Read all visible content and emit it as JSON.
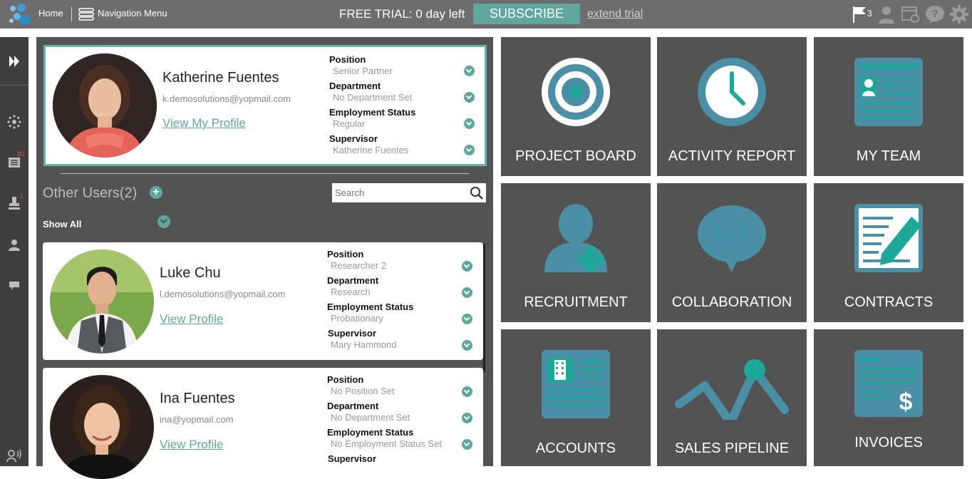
{
  "topbar": {
    "home_label": "Home",
    "nav_label": "Navigation Menu",
    "trial_text": "FREE TRIAL: 0 day left",
    "subscribe_label": "SUBSCRIBE",
    "extend_label": "extend trial",
    "flag_count": "3"
  },
  "sidebar": {
    "badges": {
      "messages": "20",
      "approvals": "1"
    }
  },
  "me": {
    "name": "Katherine Fuentes",
    "email": "k.demosolutions@yopmail.com",
    "view_label": "View My Profile",
    "fields": [
      {
        "label": "Position",
        "value": "Senior Partner"
      },
      {
        "label": "Department",
        "value": "No Department Set"
      },
      {
        "label": "Employment Status",
        "value": "Regular"
      },
      {
        "label": "Supervisor",
        "value": "Katherine Fuentes"
      }
    ]
  },
  "other_users": {
    "title": "Other Users(2)",
    "search_placeholder": "Search",
    "show_all_label": "Show All",
    "users": [
      {
        "name": "Luke Chu",
        "email": "l.demosolutions@yopmail.com",
        "view_label": "View Profile",
        "fields": [
          {
            "label": "Position",
            "value": "Researcher 2"
          },
          {
            "label": "Department",
            "value": "Research"
          },
          {
            "label": "Employment Status",
            "value": "Probationary"
          },
          {
            "label": "Supervisor",
            "value": "Mary Hammond"
          }
        ]
      },
      {
        "name": "Ina Fuentes",
        "email": "ina@yopmail.com",
        "view_label": "View Profile",
        "fields": [
          {
            "label": "Position",
            "value": "No Position Set"
          },
          {
            "label": "Department",
            "value": "No Department Set"
          },
          {
            "label": "Employment Status",
            "value": "No Employment Status Set"
          },
          {
            "label": "Supervisor",
            "value": ""
          }
        ]
      }
    ]
  },
  "tiles": [
    {
      "label": "PROJECT BOARD",
      "icon": "target-icon"
    },
    {
      "label": "ACTIVITY REPORT",
      "icon": "clock-icon"
    },
    {
      "label": "MY TEAM",
      "icon": "id-card-icon"
    },
    {
      "label": "RECRUITMENT",
      "icon": "add-person-icon"
    },
    {
      "label": "COLLABORATION",
      "icon": "chat-bubble-icon"
    },
    {
      "label": "CONTRACTS",
      "icon": "document-pen-icon"
    },
    {
      "label": "ACCOUNTS",
      "icon": "building-document-icon"
    },
    {
      "label": "SALES PIPELINE",
      "icon": "line-graph-icon"
    },
    {
      "label": "INVOICES",
      "icon": "invoice-dollar-icon"
    }
  ],
  "colors": {
    "accent": "#5fa79e",
    "tile_icon": "#4a8fa6",
    "tile_bg": "#535353"
  }
}
